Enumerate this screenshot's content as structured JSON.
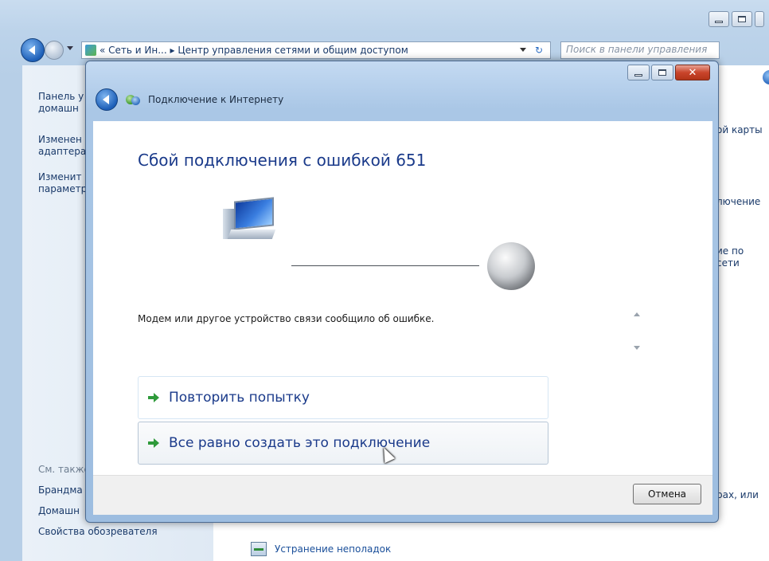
{
  "background_window": {
    "breadcrumb": "« Сеть и Ин... ▸ Центр управления сетями и общим доступом",
    "search_placeholder": "Поиск в панели управления",
    "refresh_glyph": "↻",
    "left_links": [
      "Панель у",
      "домашн",
      "Изменен",
      "адаптера",
      "Изменит",
      "параметр"
    ],
    "see_also_label": "См. также",
    "see_also_links": [
      "Брандма",
      "Домашн",
      "Свойства обозревателя"
    ],
    "right_fragments": [
      "ой карты",
      "лючение",
      "ие по",
      "сети",
      "рах, или"
    ],
    "troubleshoot_label": "Устранение неполадок"
  },
  "dialog": {
    "title": "Подключение к Интернету",
    "close_glyph": "✕",
    "heading": "Сбой подключения с ошибкой 651",
    "detail": "Модем или другое устройство связи сообщило об ошибке.",
    "options": [
      {
        "label": "Повторить попытку"
      },
      {
        "label": "Все равно создать это подключение"
      }
    ],
    "cancel_label": "Отмена"
  }
}
